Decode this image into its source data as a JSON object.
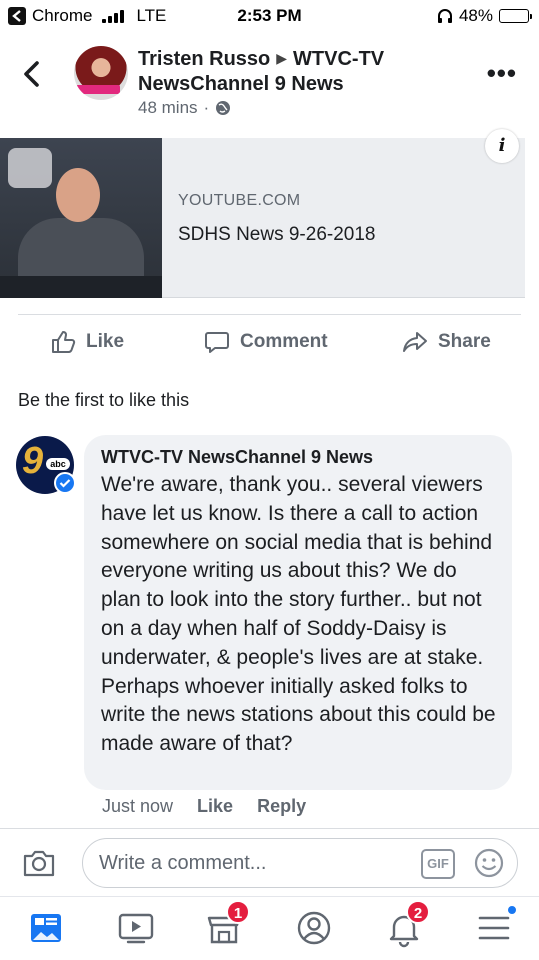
{
  "status_bar": {
    "carrier": "Chrome",
    "network": "LTE",
    "time": "2:53 PM",
    "battery": "48%",
    "battery_level": 0.48
  },
  "post_header": {
    "author": "Tristen Russo",
    "page": "WTVC-TV NewsChannel 9 News",
    "time": "48 mins",
    "separator": "·"
  },
  "link_card": {
    "source": "YOUTUBE.COM",
    "title": "SDHS News 9-26-2018",
    "info_glyph": "i"
  },
  "actions": {
    "like": "Like",
    "comment": "Comment",
    "share": "Share"
  },
  "reactions": {
    "summary": "Be the first to like this"
  },
  "comment": {
    "author": "WTVC-TV NewsChannel 9 News",
    "avatar_abc": "abc",
    "avatar_nine": "9",
    "text": "We're aware, thank you.. several viewers have let us know. Is there a call to action somewhere on social media that is behind everyone writing us about this? We do plan to look into the story further.. but not on a day when half of Soddy-Daisy is underwater, & people's lives are at stake. Perhaps whoever initially asked folks to write the news stations about this could be made aware of that?",
    "time": "Just now",
    "like": "Like",
    "reply": "Reply"
  },
  "composer": {
    "placeholder": "Write a comment...",
    "gif": "GIF"
  },
  "bottom_nav": {
    "marketplace_badge": "1",
    "notifications_badge": "2"
  },
  "colors": {
    "text": "#1c1e21",
    "secondary": "#606770",
    "badge": "#e41e3f",
    "accent": "#1877f2"
  }
}
